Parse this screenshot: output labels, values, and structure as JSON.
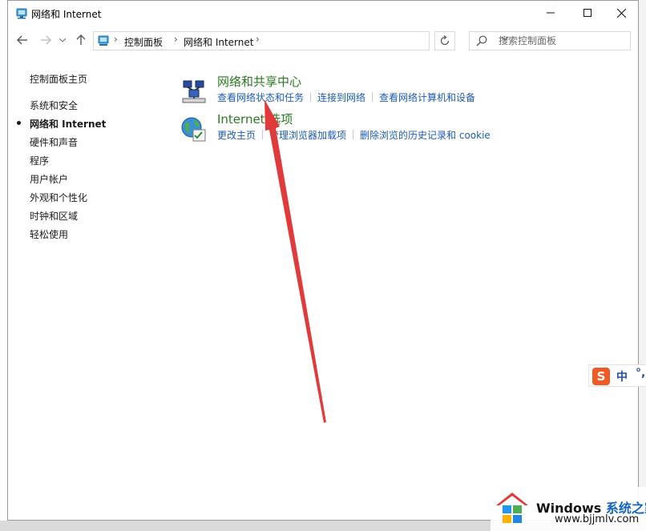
{
  "window": {
    "title": "网络和 Internet"
  },
  "address": {
    "crumbs": [
      "控制面板",
      "网络和 Internet"
    ],
    "search_placeholder": "搜索控制面板"
  },
  "sidebar": {
    "items": [
      {
        "label": "控制面板主页",
        "active": false
      },
      {
        "label": "系统和安全",
        "active": false
      },
      {
        "label": "网络和 Internet",
        "active": true
      },
      {
        "label": "硬件和声音",
        "active": false
      },
      {
        "label": "程序",
        "active": false
      },
      {
        "label": "用户帐户",
        "active": false
      },
      {
        "label": "外观和个性化",
        "active": false
      },
      {
        "label": "时钟和区域",
        "active": false
      },
      {
        "label": "轻松使用",
        "active": false
      }
    ]
  },
  "categories": [
    {
      "title": "网络和共享中心",
      "icon": "network-sharing-icon",
      "links": [
        "查看网络状态和任务",
        "连接到网络",
        "查看网络计算机和设备"
      ]
    },
    {
      "title": "Internet 选项",
      "icon": "internet-options-icon",
      "links": [
        "更改主页",
        "管理浏览器加载项",
        "删除浏览的历史记录和 cookie"
      ]
    }
  ],
  "ime": {
    "logo": "S",
    "mode": "中",
    "punct": "°,"
  },
  "watermark": {
    "brand": "Windows",
    "suffix": "系统之家",
    "url": "www.bjjmlv.com"
  },
  "colors": {
    "category_title": "#2a7a1f",
    "link": "#1c5bb5",
    "annotation_arrow": "#e03a3a"
  }
}
